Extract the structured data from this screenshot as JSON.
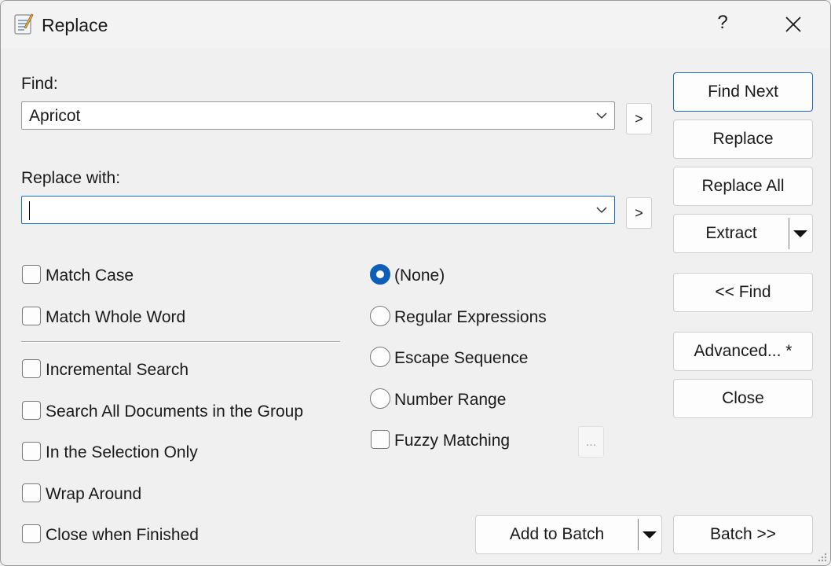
{
  "window": {
    "title": "Replace",
    "help_label": "?"
  },
  "find": {
    "label": "Find:",
    "value": "Apricot",
    "history_button": ">"
  },
  "replace": {
    "label": "Replace with:",
    "value": "",
    "history_button": ">"
  },
  "buttons": {
    "find_next": "Find Next",
    "replace": "Replace",
    "replace_all": "Replace All",
    "extract": "Extract",
    "less_find": "<< Find",
    "advanced": "Advanced... *",
    "close": "Close",
    "add_to_batch": "Add to Batch",
    "batch": "Batch >>",
    "fuzzy_options": "..."
  },
  "options": {
    "match_case": "Match Case",
    "match_whole_word": "Match Whole Word",
    "incremental_search": "Incremental Search",
    "search_all_docs": "Search All Documents in the Group",
    "selection_only": "In the Selection Only",
    "wrap_around": "Wrap Around",
    "close_when_finished": "Close when Finished"
  },
  "modes": {
    "none": "(None)",
    "regex": "Regular Expressions",
    "escape": "Escape Sequence",
    "number_range": "Number Range",
    "fuzzy": "Fuzzy Matching"
  },
  "colors": {
    "accent": "#0f5fb8",
    "default_border": "#1b6ec2"
  }
}
